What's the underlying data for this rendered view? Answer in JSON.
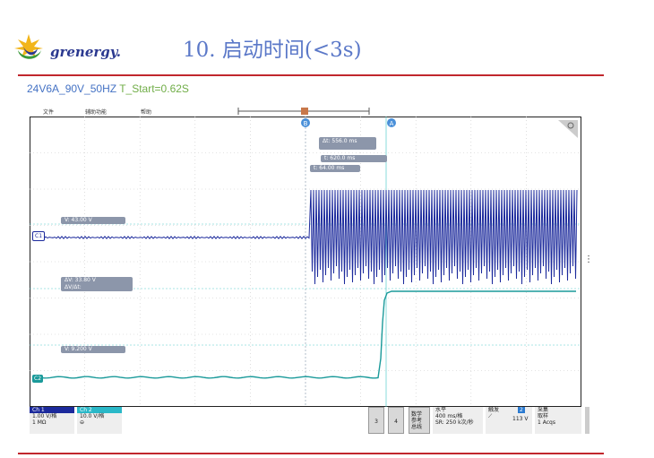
{
  "slide": {
    "logo_text": "grenergy.",
    "title": "10. 启动时间(<3s)",
    "subtitle_main": "24V6A_90V_50HZ ",
    "subtitle_highlight": "T_Start=0.62S"
  },
  "menu": {
    "file": "文件",
    "utility": "辅助功能",
    "help": "帮助"
  },
  "cursors": {
    "marker_b": "B",
    "marker_a": "A",
    "delta_t": "Δt:  556.0 ms",
    "t_a": "t:    620.0 ms",
    "t_b": "t:   64.00 ms",
    "ch1_v": "V:   43.00 V",
    "delta_v": "ΔV:      33.80 V",
    "dv_dt": "ΔV/Δt:",
    "ch2_v": "V:   9.200 V"
  },
  "channels": {
    "c1_label": "C1",
    "c2_label": "C2",
    "ch1": {
      "name": "Ch 1",
      "scale": "1.00 V/格",
      "impedance": "1 MΩ",
      "color": "#1c2a9c"
    },
    "ch2": {
      "name": "Ch 2",
      "scale": "10.0 V/格",
      "color": "#1a9a9a"
    }
  },
  "bottom": {
    "btn3": "3",
    "btn4": "4",
    "math": "数学",
    "ref": "参考",
    "bus": "总线",
    "horizontal_title": "水平",
    "horizontal_scale": "400 ms/格",
    "horizontal_sr": "SR: 250 k次/秒",
    "trigger_title": "触发",
    "trigger_source": "2",
    "trigger_level": "113 V",
    "acq_title": "采集",
    "acq_mode": "取样",
    "acq_count": "1 Acqs"
  }
}
